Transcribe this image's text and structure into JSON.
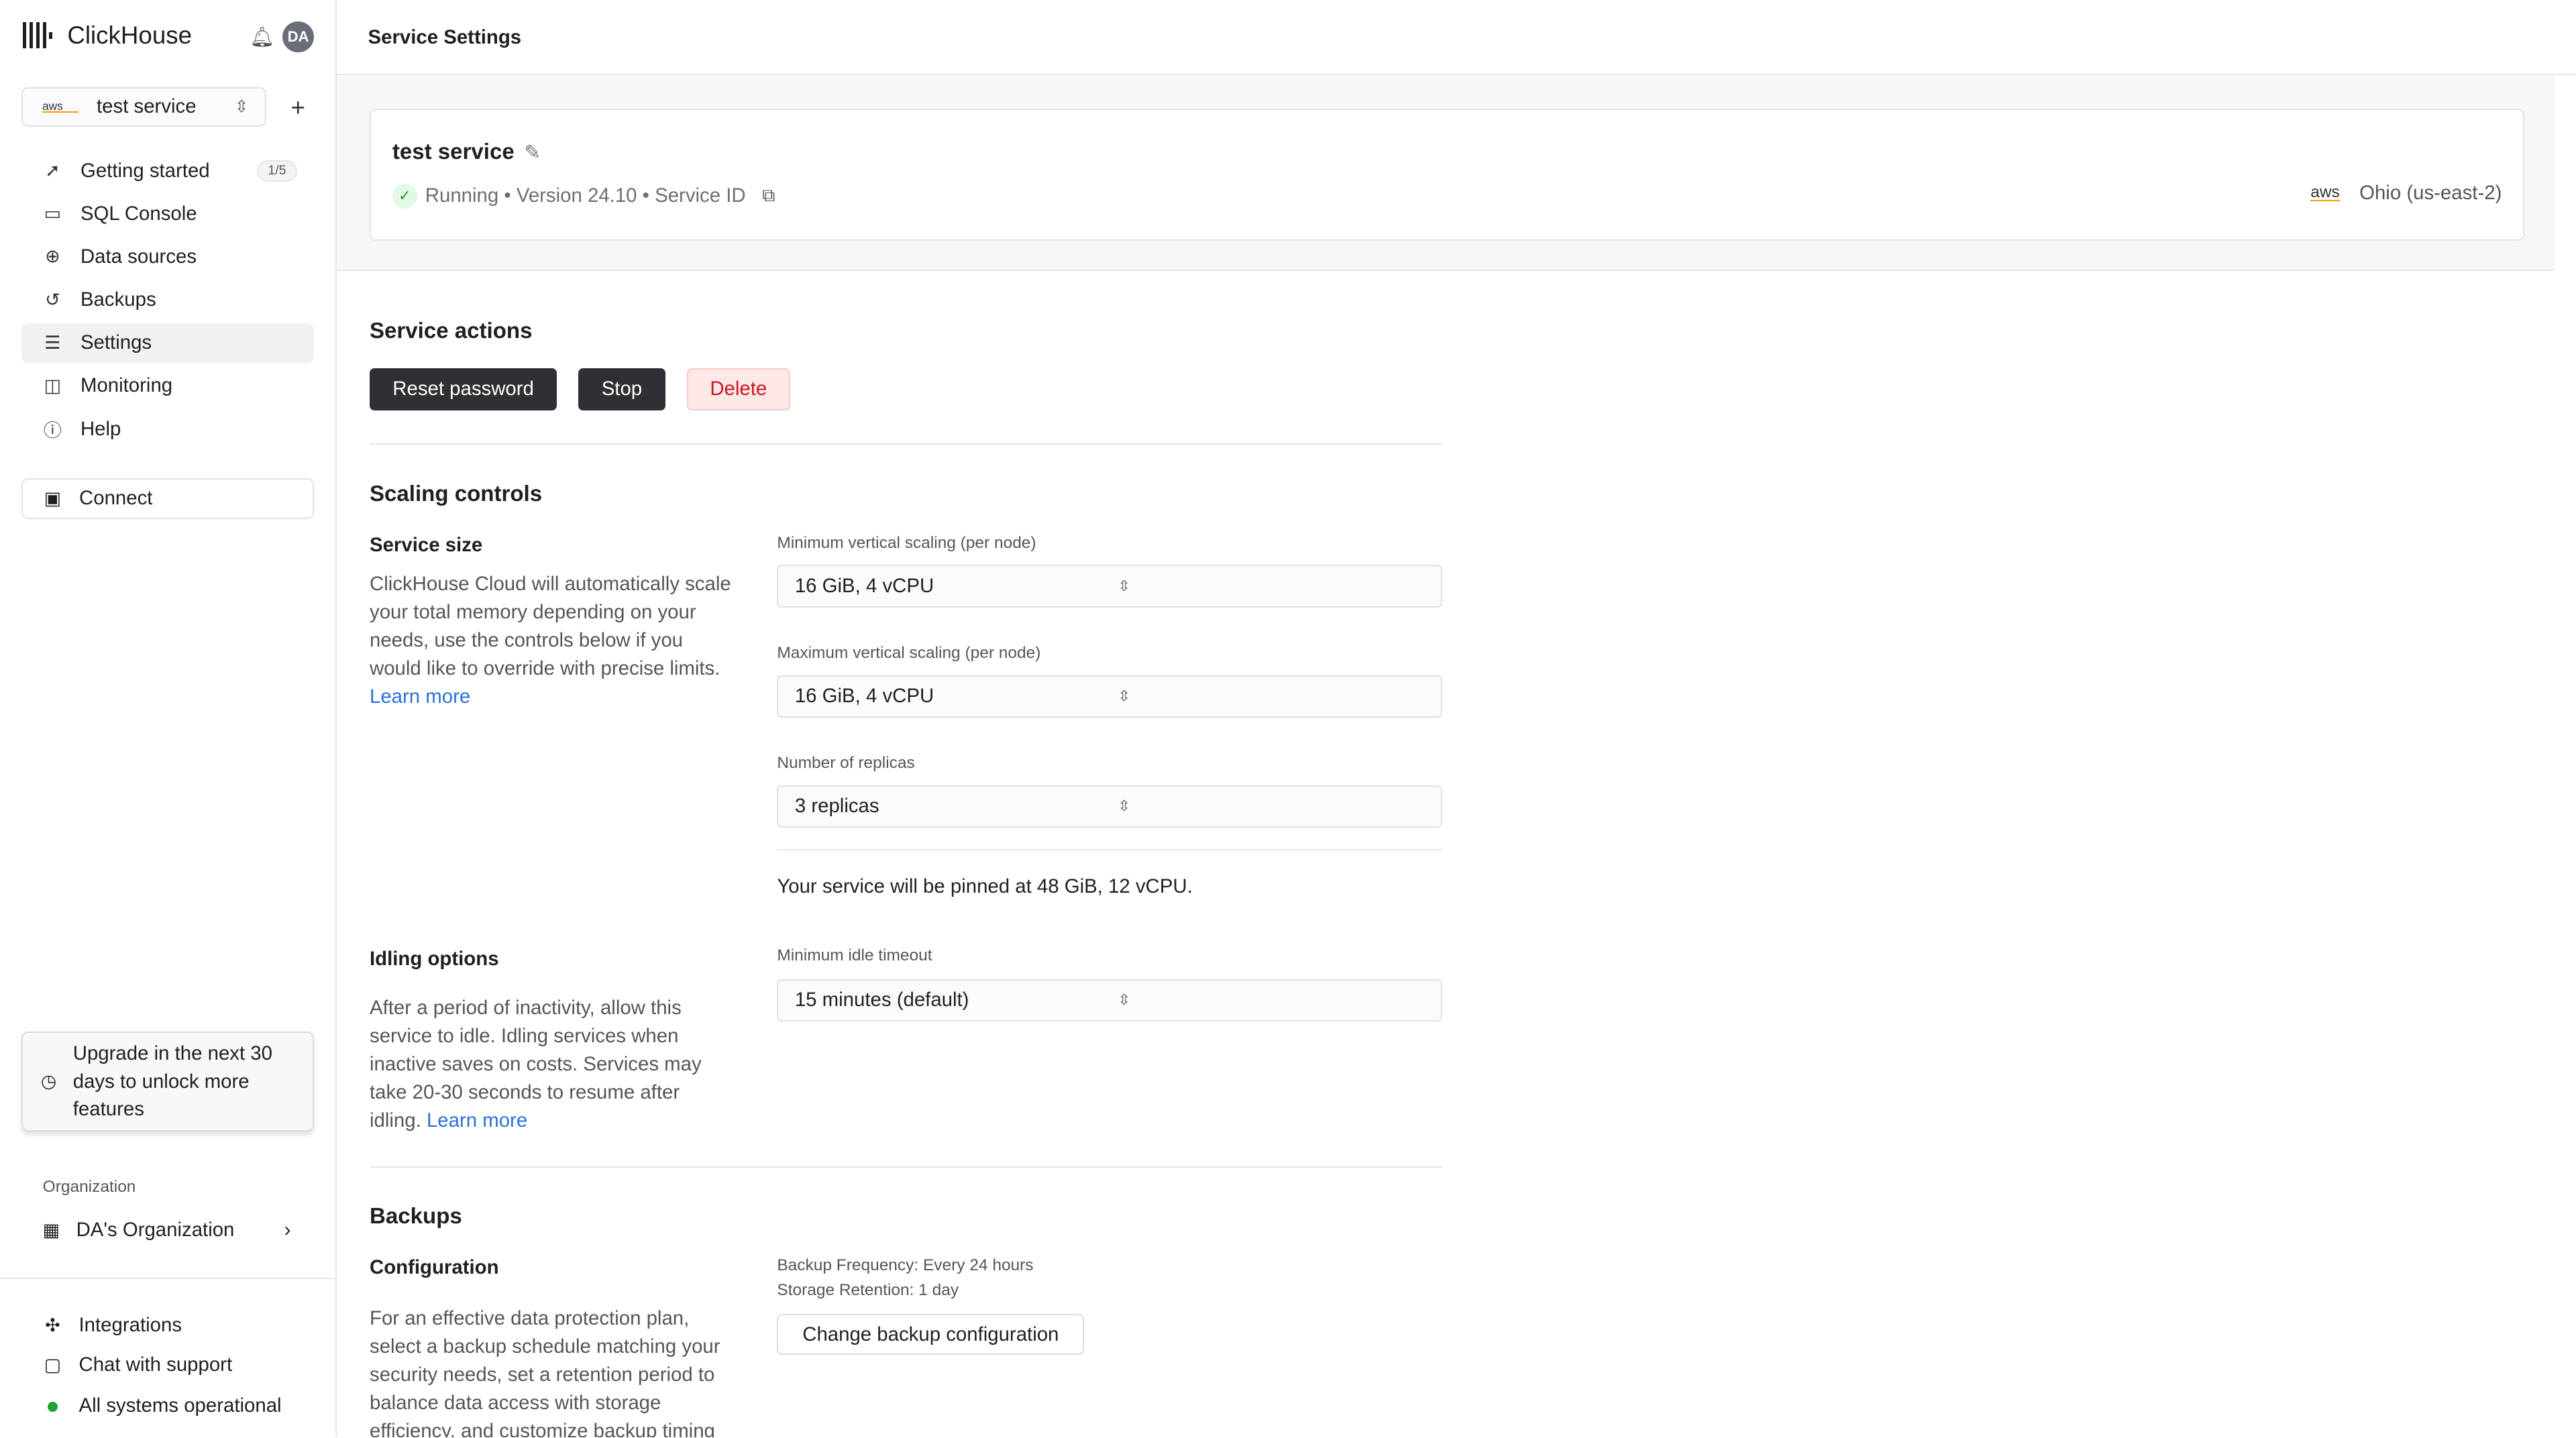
{
  "app": {
    "name": "ClickHouse",
    "avatar": "DA"
  },
  "service_selector": {
    "provider": "aws",
    "value": "test service"
  },
  "nav": [
    {
      "label": "Getting started",
      "icon": "rocket-icon",
      "badge": "1/5"
    },
    {
      "label": "SQL Console",
      "icon": "console-icon"
    },
    {
      "label": "Data sources",
      "icon": "data-sources-icon"
    },
    {
      "label": "Backups",
      "icon": "backup-icon"
    },
    {
      "label": "Settings",
      "icon": "settings-sliders-icon",
      "active": true
    },
    {
      "label": "Monitoring",
      "icon": "monitoring-icon"
    },
    {
      "label": "Help",
      "icon": "help-icon"
    }
  ],
  "connect": "Connect",
  "upgrade": "Upgrade in the next 30 days to unlock more features",
  "org": {
    "label": "Organization",
    "name": "DA's Organization"
  },
  "bottom": [
    {
      "label": "Integrations"
    },
    {
      "label": "Chat with support"
    },
    {
      "label": "All systems operational",
      "status_color": "#1ca43b"
    }
  ],
  "header": {
    "title": "Service Settings"
  },
  "service": {
    "name": "test service",
    "status": "Running",
    "version": "Version 24.10",
    "id_label": "Service ID",
    "provider": "aws",
    "region": "Ohio (us-east-2)"
  },
  "actions": {
    "title": "Service actions",
    "reset": "Reset password",
    "stop": "Stop",
    "delete": "Delete"
  },
  "scaling": {
    "title": "Scaling controls",
    "size_title": "Service size",
    "size_desc": "ClickHouse Cloud will automatically scale your total memory depending on your needs, use the controls below if you would like to override with precise limits.",
    "learn_more": "Learn more",
    "min_label": "Minimum vertical scaling (per node)",
    "min_value": "16 GiB, 4 vCPU",
    "max_label": "Maximum vertical scaling (per node)",
    "max_value": "16 GiB, 4 vCPU",
    "replicas_label": "Number of replicas",
    "replicas_value": "3 replicas",
    "pinned": "Your service will be pinned at 48 GiB, 12 vCPU.",
    "idle_title": "Idling options",
    "idle_desc": "After a period of inactivity, allow this service to idle. Idling services when inactive saves on costs. Services may take 20-30 seconds to resume after idling.",
    "idle_learn": "Learn more",
    "idle_label": "Minimum idle timeout",
    "idle_value": "15 minutes (default)"
  },
  "backups": {
    "title": "Backups",
    "config_title": "Configuration",
    "desc": "For an effective data protection plan, select a backup schedule matching your security needs, set a retention period to balance data access with storage efficiency, and customize backup timing",
    "frequency": "Backup Frequency: Every 24 hours",
    "retention": "Storage Retention: 1 day",
    "change": "Change backup configuration"
  }
}
